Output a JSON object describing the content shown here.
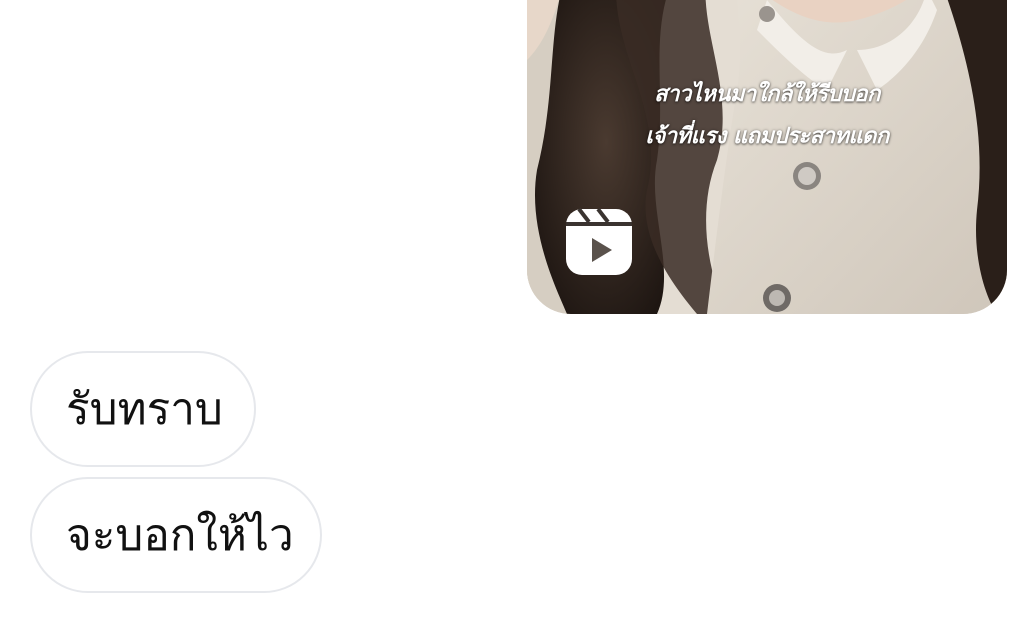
{
  "reel": {
    "caption_line1": "สาวไหนมาใกล้ให้รีบบอก",
    "caption_line2": "เจ้าที่แรง แถมประสาทแดก",
    "icon": "reels-icon"
  },
  "quick_replies": [
    {
      "label": "รับทราบ"
    },
    {
      "label": "จะบอกให้ไว"
    }
  ],
  "colors": {
    "chip_border": "#e6e8ec",
    "chip_text": "#111111",
    "caption_text": "#ffffff",
    "background": "#ffffff"
  }
}
